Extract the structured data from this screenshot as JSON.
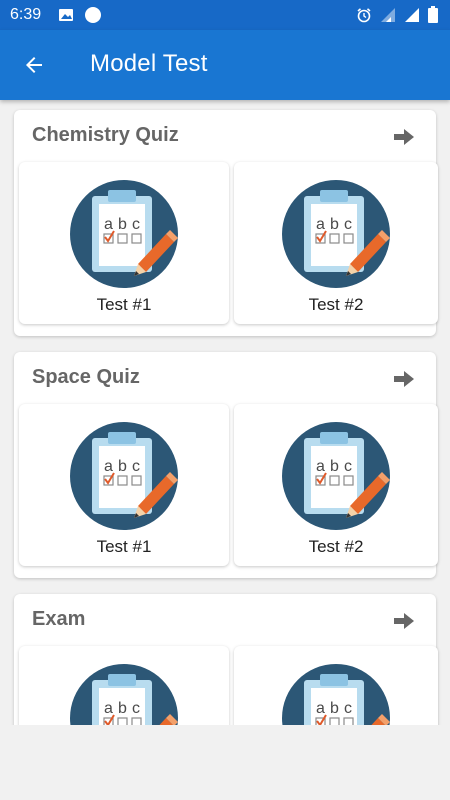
{
  "status_bar": {
    "time": "6:39"
  },
  "app_bar": {
    "title": "Model Test",
    "back_icon": "arrow-left-icon"
  },
  "quizzes": [
    {
      "title": "Chemistry Quiz",
      "tests": [
        {
          "label": "Test #1"
        },
        {
          "label": "Test #2"
        }
      ]
    },
    {
      "title": "Space Quiz",
      "tests": [
        {
          "label": "Test #1"
        },
        {
          "label": "Test #2"
        }
      ]
    },
    {
      "title": "Exam",
      "tests": [
        {
          "label": ""
        },
        {
          "label": ""
        }
      ]
    }
  ],
  "colors": {
    "status_bar": "#1769c7",
    "app_bar": "#1976d2",
    "icon_circle": "#2c5776",
    "pencil": "#e8692a",
    "clipboard": "#b8dcef",
    "check": "#e05a2a"
  }
}
